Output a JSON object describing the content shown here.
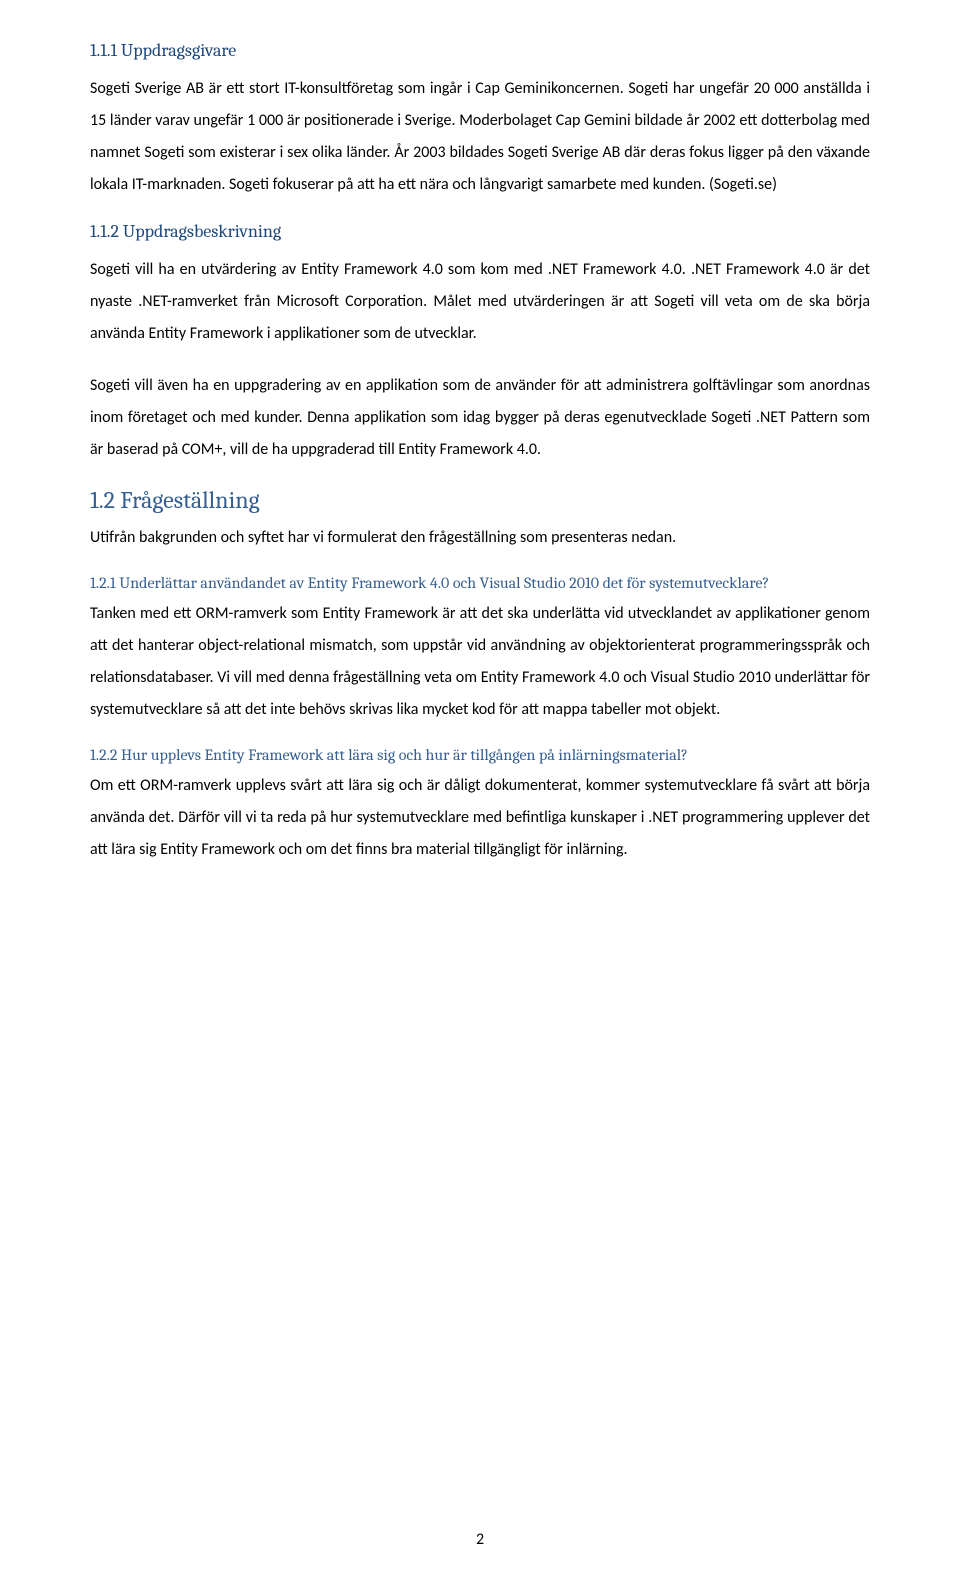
{
  "s1": {
    "heading": "1.1.1 Uppdragsgivare",
    "p1": "Sogeti Sverige AB är ett stort IT-konsultföretag som ingår i Cap Geminikoncernen. Sogeti har ungefär 20 000 anställda i 15 länder varav ungefär 1 000 är positionerade i Sverige. Moderbolaget Cap Gemini bildade år 2002 ett dotterbolag med namnet Sogeti som existerar i sex olika länder. År 2003 bildades Sogeti Sverige AB där deras fokus ligger på den växande lokala IT-marknaden. Sogeti fokuserar på att ha ett nära och långvarigt samarbete med kunden. (Sogeti.se)"
  },
  "s2": {
    "heading": "1.1.2 Uppdragsbeskrivning",
    "p1": "Sogeti vill ha en utvärdering av Entity Framework 4.0 som kom med .NET Framework 4.0. .NET Framework 4.0 är det nyaste .NET-ramverket från Microsoft Corporation. Målet med utvärderingen är att Sogeti vill veta om de ska börja använda Entity Framework i applikationer som de utvecklar.",
    "p2": "Sogeti vill även ha en uppgradering av en applikation som de använder för att administrera golftävlingar som anordnas inom företaget och med kunder. Denna applikation som idag bygger på deras egenutvecklade Sogeti .NET Pattern som är baserad på COM+, vill de ha uppgraderad till Entity Framework 4.0."
  },
  "s3": {
    "heading": "1.2 Frågeställning",
    "p1": "Utifrån bakgrunden och syftet har vi formulerat den frågeställning som presenteras nedan."
  },
  "s4": {
    "heading": "1.2.1 Underlättar användandet av Entity Framework 4.0 och Visual Studio 2010 det för systemutvecklare?",
    "p1": "Tanken med ett ORM-ramverk som Entity Framework är att det ska underlätta vid utvecklandet av applikationer genom att det hanterar object-relational mismatch, som uppstår vid användning av objektorienterat programmeringsspråk och relationsdatabaser. Vi vill med denna frågeställning veta om Entity Framework 4.0 och Visual Studio 2010 underlättar för systemutvecklare så att det inte behövs skrivas lika mycket kod för att mappa tabeller mot objekt."
  },
  "s5": {
    "heading": "1.2.2 Hur upplevs Entity Framework att lära sig och hur är tillgången på inlärningsmaterial?",
    "p1": "Om ett ORM-ramverk upplevs svårt att lära sig och är dåligt dokumenterat, kommer systemutvecklare få svårt att börja använda det. Därför vill vi ta reda på hur systemutvecklare med befintliga kunskaper i .NET programmering upplever det att lära sig Entity Framework och om det finns bra material tillgängligt för inlärning."
  },
  "pageNumber": "2"
}
